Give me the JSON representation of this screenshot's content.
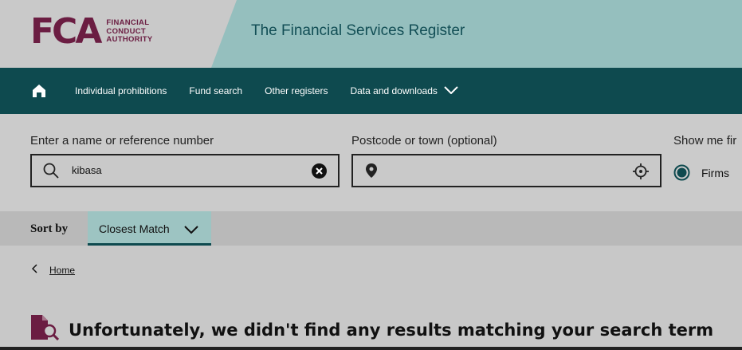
{
  "header": {
    "logo_mark": "FCA",
    "logo_words": [
      "FINANCIAL",
      "CONDUCT",
      "AUTHORITY"
    ],
    "site_title": "The Financial Services Register"
  },
  "nav": {
    "items": [
      {
        "label": "Individual prohibitions"
      },
      {
        "label": "Fund search"
      },
      {
        "label": "Other registers"
      },
      {
        "label": "Data and downloads"
      }
    ]
  },
  "search": {
    "name_label": "Enter a name or reference number",
    "name_value": "kibasa",
    "postcode_label": "Postcode or town (optional)",
    "postcode_value": "",
    "show_me_label": "Show me fir",
    "firms_label": "Firms"
  },
  "sort": {
    "label": "Sort by",
    "selected": "Closest Match"
  },
  "breadcrumb": {
    "home": "Home"
  },
  "results": {
    "message": "Unfortunately, we didn't find any results matching your search term"
  },
  "colors": {
    "brand": "#6b1d42",
    "nav_bg": "#0e4a4f",
    "header_teal": "#95bfbe",
    "sort_select": "#9dc4c2"
  }
}
